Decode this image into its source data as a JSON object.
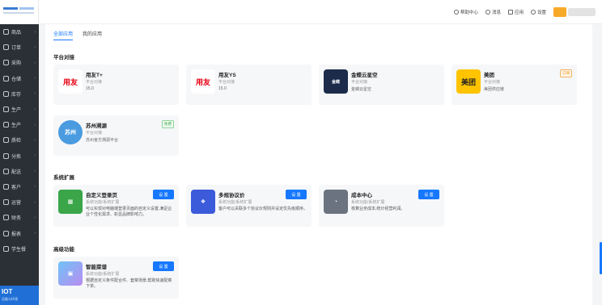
{
  "sidebar": {
    "items": [
      {
        "label": "商品"
      },
      {
        "label": "订单"
      },
      {
        "label": "采购"
      },
      {
        "label": "仓储"
      },
      {
        "label": "库存"
      },
      {
        "label": "生产"
      },
      {
        "label": "生产"
      },
      {
        "label": "质检"
      },
      {
        "label": "分拣"
      },
      {
        "label": "配送"
      },
      {
        "label": "客户"
      },
      {
        "label": "运营"
      },
      {
        "label": "财务"
      },
      {
        "label": "报表"
      },
      {
        "label": "学生餐"
      }
    ],
    "promo": {
      "big": "IOT",
      "small": "设备与环境"
    }
  },
  "topbar": {
    "help": "帮助中心",
    "messages": "消息",
    "apps": "应用",
    "settings": "设置"
  },
  "tabs": [
    {
      "label": "全部应用",
      "active": true
    },
    {
      "label": "我的应用",
      "active": false
    }
  ],
  "sections": [
    {
      "title": "平台对接"
    },
    {
      "title": "系统扩展"
    },
    {
      "title": "高级功能"
    }
  ],
  "cards": {
    "yongyou_t": {
      "logo": "用友",
      "title": "用友T+",
      "sub": "平台对接",
      "ver": "15.0"
    },
    "yongyou_ys": {
      "logo": "用友",
      "title": "用友YS",
      "sub": "平台对接",
      "ver": "15.0"
    },
    "kingdee": {
      "logo": "金蝶",
      "title": "金蝶云星空",
      "sub": "平台对接",
      "ver": "金蝶云星空"
    },
    "meituan": {
      "logo": "美团",
      "title": "美团",
      "sub": "平台对接",
      "ver": "美团供应链",
      "tag": "订阅"
    },
    "suzhou": {
      "logo": "苏州",
      "title": "苏州溯源",
      "sub": "平台对接",
      "ver": "苏州官方溯源平台",
      "tag": "免费"
    },
    "custom_login": {
      "title": "自定义登录页",
      "sub": "系统功能/系统扩展",
      "desc": "可以实现对电脑端登录页面的自定义设置,满足企业个性化需求、彰显品牌影响力。",
      "btn": "设 置"
    },
    "multi_price": {
      "title": "多规协议价",
      "sub": "系统功能/系统扩展",
      "desc": "客户可以关联多个协议价规则并设定优先级顺序。",
      "btn": "设 置"
    },
    "cost_center": {
      "title": "成本中心",
      "sub": "系统功能/系统扩展",
      "desc": "核算业务成本,统计经营利润。",
      "btn": "设 置"
    },
    "smart_menu": {
      "title": "智能菜谱",
      "sub": "系统功能/系统扩展",
      "desc": "根据自定义条件配合件、套菜场景,帮助快速配菜下单。",
      "btn": "设 置"
    }
  },
  "colors": {
    "accent": "#1677ff",
    "sidebar_bg": "#2b2f36",
    "yongyou_red": "#e60012",
    "kingdee_navy": "#1c2b4a",
    "meituan_yellow": "#ffc300",
    "suzhou_blue": "#4a9be0"
  }
}
